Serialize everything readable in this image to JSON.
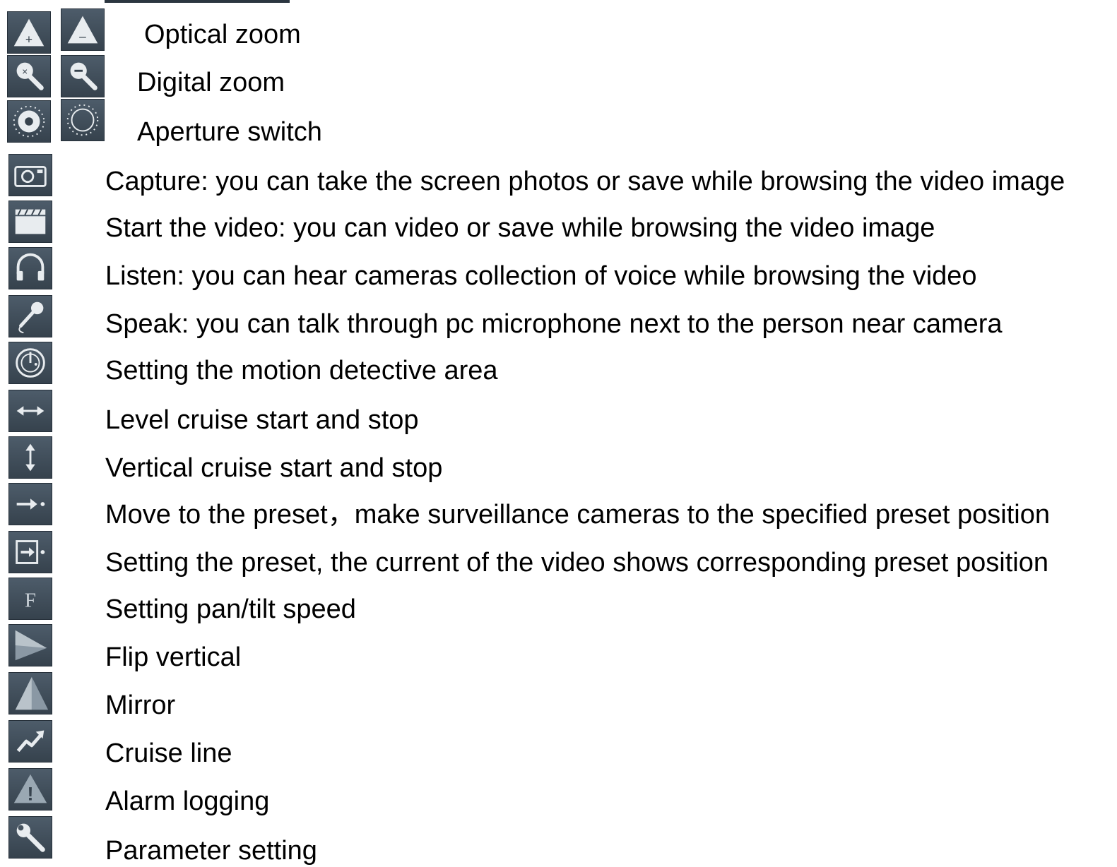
{
  "pairs": [
    {
      "label": "Optical zoom",
      "icons": [
        "optical-zoom-in-icon",
        "optical-zoom-out-icon"
      ]
    },
    {
      "label": "Digital zoom",
      "icons": [
        "digital-zoom-in-icon",
        "digital-zoom-out-icon"
      ]
    },
    {
      "label": "Aperture switch",
      "icons": [
        "aperture-open-icon",
        "aperture-close-icon"
      ]
    }
  ],
  "items": [
    {
      "label": "Capture: you can take the screen photos or save while browsing the video image",
      "icon": "camera-icon"
    },
    {
      "label": "Start the video: you can video or save while browsing the video image",
      "icon": "clapperboard-icon"
    },
    {
      "label": "Listen: you can hear cameras collection of voice while browsing the video",
      "icon": "headphones-icon"
    },
    {
      "label": "Speak: you can talk through pc microphone next to the person near camera",
      "icon": "microphone-icon"
    },
    {
      "label": "Setting the motion detective area",
      "icon": "motion-radar-icon"
    },
    {
      "label": "Level cruise start and stop",
      "icon": "horizontal-arrows-icon"
    },
    {
      "label": "Vertical cruise start and stop",
      "icon": "vertical-arrows-icon"
    },
    {
      "label": "Move to the preset，make surveillance cameras to the specified preset position",
      "icon": "move-to-preset-icon"
    },
    {
      "label": "Setting the preset, the current of the video shows corresponding preset position",
      "icon": "set-preset-icon"
    },
    {
      "label": "Setting pan/tilt speed",
      "icon": "speed-icon"
    },
    {
      "label": "Flip vertical",
      "icon": "flip-vertical-icon"
    },
    {
      "label": "Mirror",
      "icon": "mirror-icon"
    },
    {
      "label": "Cruise line",
      "icon": "cruise-line-icon"
    },
    {
      "label": "Alarm logging",
      "icon": "alarm-icon"
    },
    {
      "label": "Parameter setting",
      "icon": "wrench-icon"
    }
  ]
}
